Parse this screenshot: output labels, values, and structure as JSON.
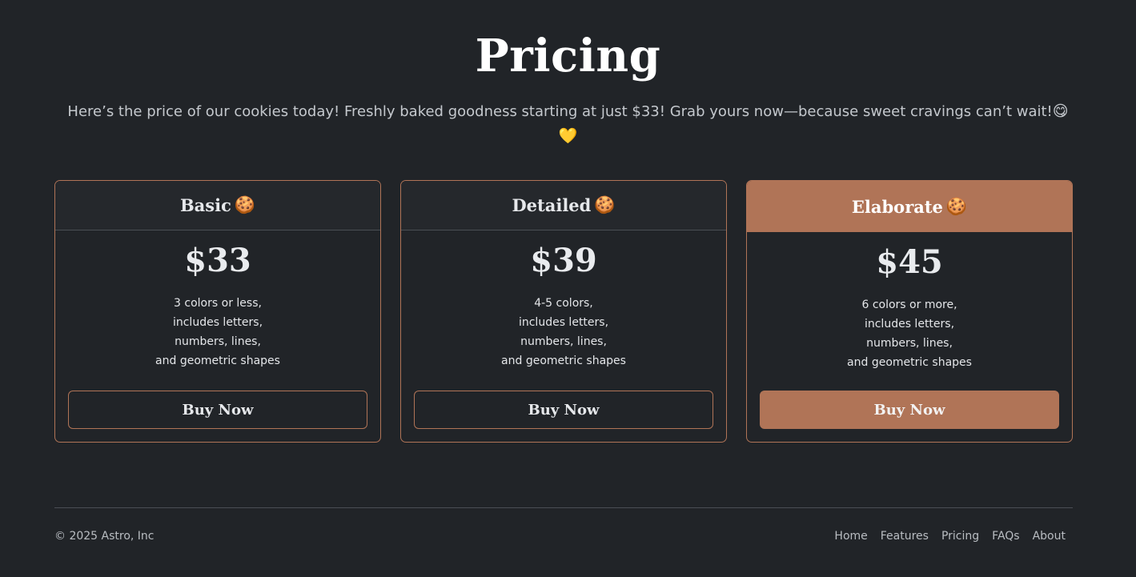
{
  "pricing": {
    "title": "Pricing",
    "subtitle": "Here’s the price of our cookies today! Freshly baked goodness starting at just $33! Grab yours now—because sweet cravings can’t wait!",
    "subtitle_emoji_1": "😋",
    "subtitle_emoji_2": "💛",
    "plans": [
      {
        "name": "Basic",
        "emoji": "🍪",
        "price": "$33",
        "features": [
          "3 colors or less,",
          "includes letters,",
          "numbers, lines,",
          "and geometric shapes"
        ],
        "button": "Buy Now"
      },
      {
        "name": "Detailed",
        "emoji": "🍪",
        "price": "$39",
        "features": [
          "4-5 colors,",
          "includes letters,",
          "numbers, lines,",
          "and geometric shapes"
        ],
        "button": "Buy Now"
      },
      {
        "name": "Elaborate",
        "emoji": "🍪",
        "price": "$45",
        "features": [
          "6 colors or more,",
          "includes letters,",
          "numbers, lines,",
          "and geometric shapes"
        ],
        "button": "Buy Now"
      }
    ]
  },
  "footer": {
    "copyright": "© 2025 Astro, Inc",
    "links": [
      "Home",
      "Features",
      "Pricing",
      "FAQs",
      "About"
    ]
  },
  "colors": {
    "background": "#212428",
    "accent": "#b07457",
    "text": "#dcdfe3"
  }
}
